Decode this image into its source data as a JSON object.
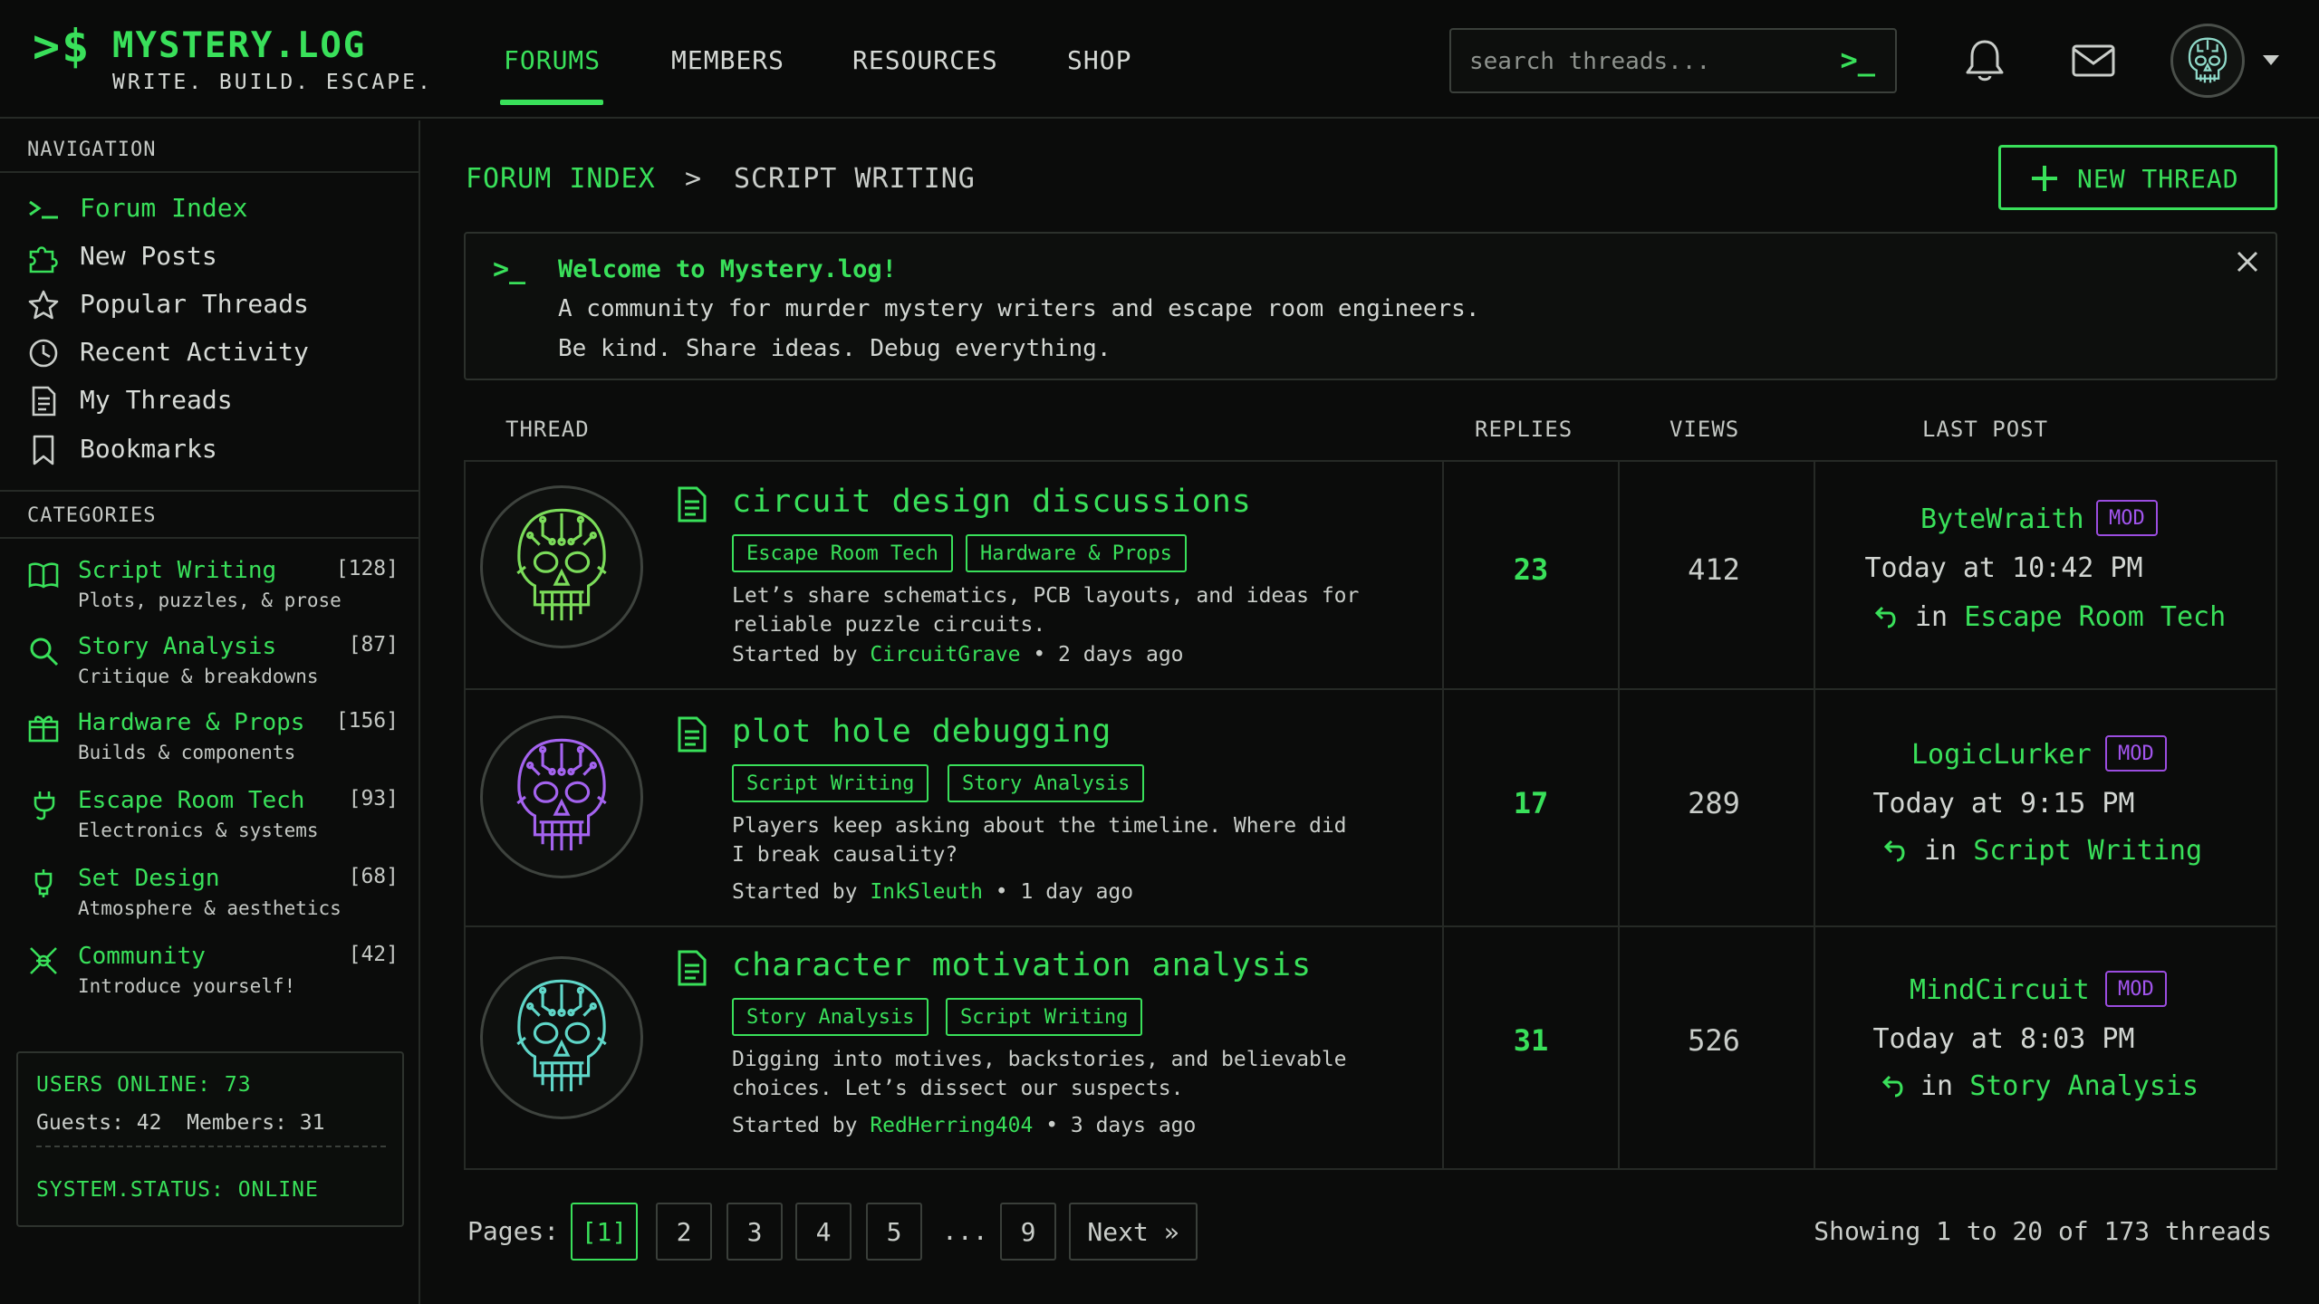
{
  "brand": {
    "prompt": ">$",
    "title": "MYSTERY.LOG",
    "tagline": "WRITE. BUILD. ESCAPE."
  },
  "nav": {
    "forums": "FORUMS",
    "members": "MEMBERS",
    "resources": "RESOURCES",
    "shop": "SHOP"
  },
  "search": {
    "placeholder": "search threads...",
    "prompt": ">_"
  },
  "icons": [
    "bell-icon",
    "mail-icon",
    "skull-avatar",
    "caret-down-icon"
  ],
  "sidebar": {
    "nav_heading": "NAVIGATION",
    "nav_items": [
      {
        "icon": "prompt-icon",
        "label": "Forum Index",
        "active": true
      },
      {
        "icon": "puzzle-icon",
        "label": "New Posts"
      },
      {
        "icon": "star-icon",
        "label": "Popular Threads"
      },
      {
        "icon": "clock-icon",
        "label": "Recent Activity"
      },
      {
        "icon": "document-icon",
        "label": "My Threads"
      },
      {
        "icon": "bookmark-icon",
        "label": "Bookmarks"
      }
    ],
    "cat_heading": "CATEGORIES",
    "categories": [
      {
        "icon": "book-icon",
        "name": "Script Writing",
        "count": "[128]",
        "desc": "Plots, puzzles, & prose"
      },
      {
        "icon": "magnifier-icon",
        "name": "Story Analysis",
        "count": "[87]",
        "desc": "Critique & breakdowns"
      },
      {
        "icon": "gift-box-icon",
        "name": "Hardware & Props",
        "count": "[156]",
        "desc": "Builds & components"
      },
      {
        "icon": "plug-icon",
        "name": "Escape Room Tech",
        "count": "[93]",
        "desc": "Electronics & systems"
      },
      {
        "icon": "lamp-icon",
        "name": "Set Design",
        "count": "[68]",
        "desc": "Atmosphere & aesthetics"
      },
      {
        "icon": "people-icon",
        "name": "Community",
        "count": "[42]",
        "desc": "Introduce yourself!"
      }
    ],
    "online": {
      "users": "USERS ONLINE: 73",
      "guests": "Guests: 42  Members: 31",
      "status": "SYSTEM.STATUS: ONLINE"
    }
  },
  "breadcrumb": {
    "root": "FORUM INDEX",
    "sep": ">",
    "current": "SCRIPT WRITING"
  },
  "new_thread_label": "NEW THREAD",
  "welcome": {
    "prompt": ">_",
    "title": "Welcome to Mystery.log!",
    "line1": "A community for murder mystery writers and escape room engineers.",
    "line2": "Be kind. Share ideas. Debug everything."
  },
  "table": {
    "headers": {
      "thread": "THREAD",
      "replies": "REPLIES",
      "views": "VIEWS",
      "last_post": "LAST POST"
    },
    "threads": [
      {
        "title": "circuit design discussions",
        "tags": [
          "Escape Room Tech",
          "Hardware & Props"
        ],
        "excerpt": "Let’s share schematics, PCB layouts, and ideas for reliable puzzle circuits.",
        "started_prefix": "Started by ",
        "author": "CircuitGrave",
        "age": " • 2 days ago",
        "replies": "23",
        "views": "412",
        "last_user": "ByteWraith",
        "badge": "MOD",
        "last_time": "Today at 10:42 PM",
        "in_prefix": "in ",
        "last_forum": "Escape Room Tech",
        "skull_color": "#7bdc5a"
      },
      {
        "title": "plot hole debugging",
        "tags": [
          "Script Writing",
          "Story Analysis"
        ],
        "excerpt": "Players keep asking about the timeline. Where did I break causality?",
        "started_prefix": "Started by ",
        "author": "InkSleuth",
        "age": " • 1 day ago",
        "replies": "17",
        "views": "289",
        "last_user": "LogicLurker",
        "badge": "MOD",
        "last_time": "Today at 9:15 PM",
        "in_prefix": "in ",
        "last_forum": "Script Writing",
        "skull_color": "#a463ef"
      },
      {
        "title": "character motivation analysis",
        "tags": [
          "Story Analysis",
          "Script Writing"
        ],
        "excerpt": "Digging into motives, backstories, and believable choices. Let’s dissect our suspects.",
        "started_prefix": "Started by ",
        "author": "RedHerring404",
        "age": " • 3 days ago",
        "replies": "31",
        "views": "526",
        "last_user": "MindCircuit",
        "badge": "MOD",
        "last_time": "Today at 8:03 PM",
        "in_prefix": "in ",
        "last_forum": "Story Analysis",
        "skull_color": "#5fd6c8"
      }
    ]
  },
  "pagination": {
    "label": "Pages:",
    "pages": [
      "[1]",
      "2",
      "3",
      "4",
      "5",
      "9"
    ],
    "ellipsis": "...",
    "next": "Next »",
    "showing": "Showing 1 to 20 of 173 threads"
  },
  "colors": {
    "accent": "#39e05a",
    "mod": "#a255ee",
    "background": "#0b0c0b"
  }
}
